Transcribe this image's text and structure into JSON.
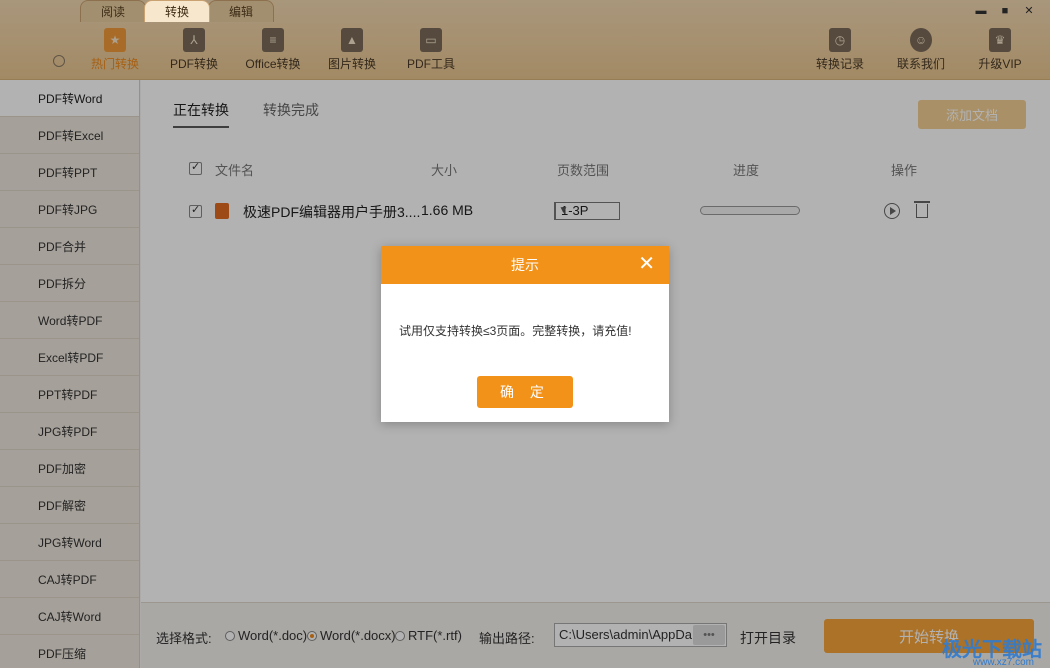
{
  "tabs": [
    "阅读",
    "转换",
    "编辑"
  ],
  "window_controls": [
    "▬",
    "■",
    "✕"
  ],
  "toolbar": {
    "left": [
      {
        "label": "热门转换",
        "icon": "star-icon"
      },
      {
        "label": "PDF转换",
        "icon": "pdf-icon"
      },
      {
        "label": "Office转换",
        "icon": "office-icon"
      },
      {
        "label": "图片转换",
        "icon": "image-icon"
      },
      {
        "label": "PDF工具",
        "icon": "briefcase-icon"
      }
    ],
    "right": [
      {
        "label": "转换记录",
        "icon": "history-icon"
      },
      {
        "label": "联系我们",
        "icon": "headset-icon"
      },
      {
        "label": "升级VIP",
        "icon": "crown-icon"
      }
    ]
  },
  "sidebar": {
    "items": [
      "PDF转Word",
      "PDF转Excel",
      "PDF转PPT",
      "PDF转JPG",
      "PDF合并",
      "PDF拆分",
      "Word转PDF",
      "Excel转PDF",
      "PPT转PDF",
      "JPG转PDF",
      "PDF加密",
      "PDF解密",
      "JPG转Word",
      "CAJ转PDF",
      "CAJ转Word",
      "PDF压缩"
    ],
    "active_index": 0
  },
  "main": {
    "subtabs": [
      "正在转换",
      "转换完成"
    ],
    "add_button": "添加文档",
    "columns": {
      "name": "文件名",
      "size": "大小",
      "pages": "页数范围",
      "progress": "进度",
      "actions": "操作"
    },
    "rows": [
      {
        "name": "极速PDF编辑器用户手册3....",
        "size": "1.66 MB",
        "pages": "1-3P",
        "progress": 0
      }
    ]
  },
  "bottom": {
    "format_label": "选择格式:",
    "formats": [
      "Word(*.doc)",
      "Word(*.docx)",
      "RTF(*.rtf)"
    ],
    "selected_format": 1,
    "path_label": "输出路径:",
    "path_value": "C:\\Users\\admin\\AppDa",
    "dots": "•••",
    "open_dir": "打开目录",
    "start_button": "开始转换"
  },
  "dialog": {
    "title": "提示",
    "close": "✕",
    "message": "试用仅支持转换≤3页面。完整转换，请充值!",
    "ok_button": "确 定"
  },
  "watermark": {
    "text": "极光下载站",
    "sub": "www.xz7.com"
  },
  "colors": {
    "accent": "#f39219",
    "topbar": "#eccb96",
    "sidebar": "#ece5dc"
  }
}
